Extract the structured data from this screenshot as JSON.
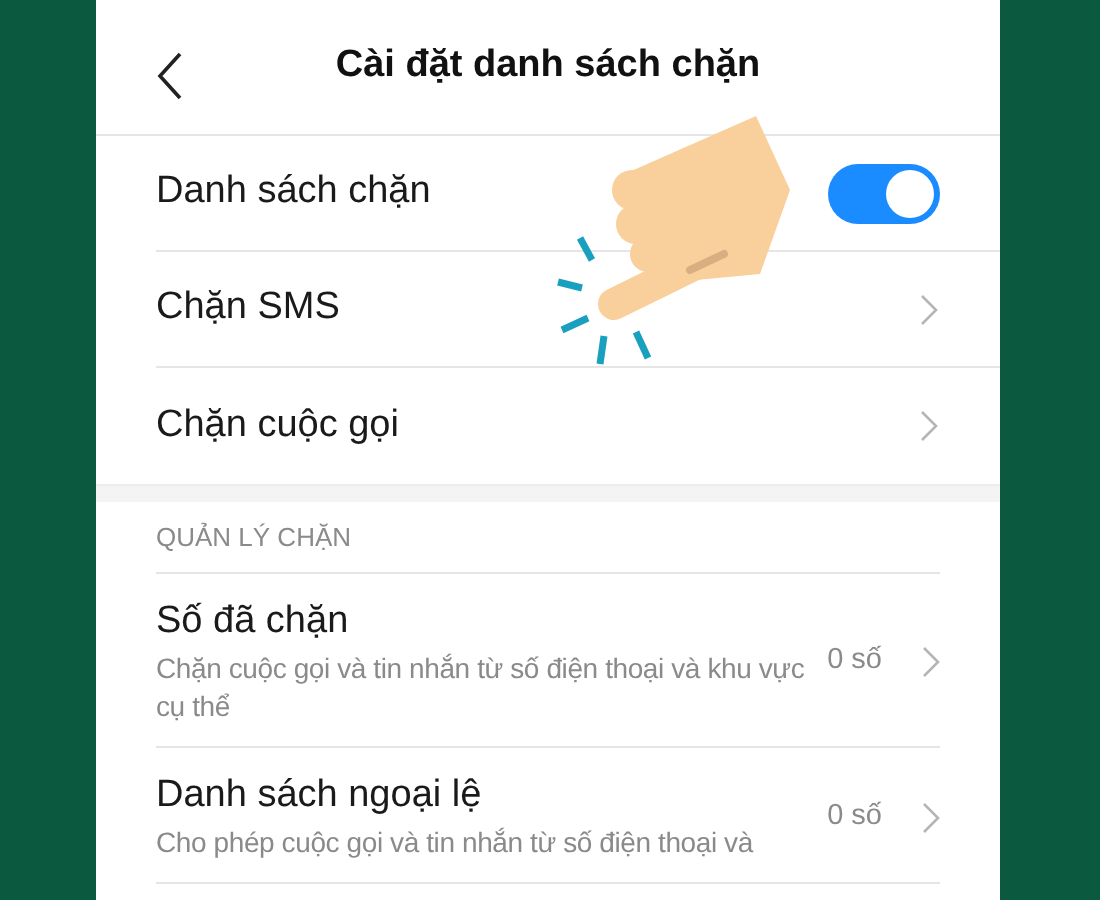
{
  "header": {
    "title": "Cài đặt danh sách chặn"
  },
  "settings": [
    {
      "kind": "toggle",
      "label": "Danh sách chặn",
      "on": true
    },
    {
      "kind": "link",
      "label": "Chặn SMS"
    },
    {
      "kind": "link",
      "label": "Chặn cuộc gọi"
    }
  ],
  "section": {
    "title": "QUẢN LÝ CHẶN",
    "items": [
      {
        "title": "Số đã chặn",
        "description": "Chặn cuộc gọi và tin nhắn từ số điện thoại và khu vực cụ thể",
        "count": "0 số"
      },
      {
        "title": "Danh sách ngoại lệ",
        "description": "Cho phép cuộc gọi và tin nhắn từ số điện thoại và",
        "count": "0 số"
      }
    ]
  },
  "overlay": {
    "kind": "tap-hand"
  }
}
